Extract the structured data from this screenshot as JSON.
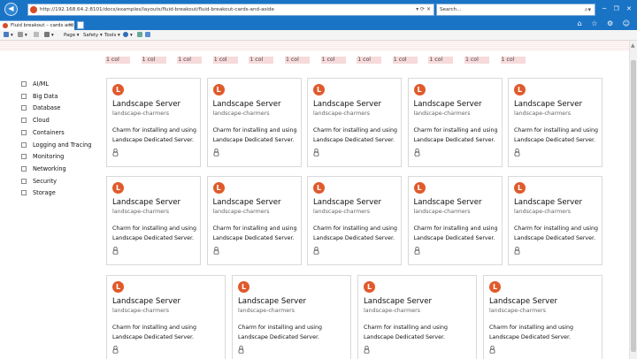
{
  "browser": {
    "url": "http://192.168.64.2:8101/docs/examples/layouts/fluid-breakout/fluid-breakout-cards-and-aside",
    "search_placeholder": "Search...",
    "tab_title": "Fluid breakout – cards and ...",
    "toolbar": {
      "page": "Page ▾",
      "safety": "Safety ▾",
      "tools": "Tools ▾"
    }
  },
  "grid_labels": [
    "1 col",
    "1 col",
    "1 col",
    "1 col",
    "1 col",
    "1 col",
    "1 col",
    "1 col",
    "1 col",
    "1 col",
    "1 col",
    "1 col"
  ],
  "filters": [
    "AI/ML",
    "Big Data",
    "Database",
    "Cloud",
    "Containers",
    "Logging and Tracing",
    "Monitoring",
    "Networking",
    "Security",
    "Storage"
  ],
  "cards": [
    {
      "title": "Landscape Server",
      "publisher": "landscape-charmers",
      "description": "Charm for installing and using Landscape Dedicated Server."
    },
    {
      "title": "Landscape Server",
      "publisher": "landscape-charmers",
      "description": "Charm for installing and using Landscape Dedicated Server."
    },
    {
      "title": "Landscape Server",
      "publisher": "landscape-charmers",
      "description": "Charm for installing and using Landscape Dedicated Server."
    },
    {
      "title": "Landscape Server",
      "publisher": "landscape-charmers",
      "description": "Charm for installing and using Landscape Dedicated Server."
    },
    {
      "title": "Landscape Server",
      "publisher": "landscape-charmers",
      "description": "Charm for installing and using Landscape Dedicated Server."
    },
    {
      "title": "Landscape Server",
      "publisher": "landscape-charmers",
      "description": "Charm for installing and using Landscape Dedicated Server."
    },
    {
      "title": "Landscape Server",
      "publisher": "landscape-charmers",
      "description": "Charm for installing and using Landscape Dedicated Server."
    },
    {
      "title": "Landscape Server",
      "publisher": "landscape-charmers",
      "description": "Charm for installing and using Landscape Dedicated Server."
    },
    {
      "title": "Landscape Server",
      "publisher": "landscape-charmers",
      "description": "Charm for installing and using Landscape Dedicated Server."
    },
    {
      "title": "Landscape Server",
      "publisher": "landscape-charmers",
      "description": "Charm for installing and using Landscape Dedicated Server."
    },
    {
      "title": "Landscape Server",
      "publisher": "landscape-charmers",
      "description": "Charm for installing and using Landscape Dedicated Server."
    },
    {
      "title": "Landscape Server",
      "publisher": "landscape-charmers",
      "description": "Charm for installing and using Landscape Dedicated Server."
    },
    {
      "title": "Landscape Server",
      "publisher": "landscape-charmers",
      "description": "Charm for installing and using Landscape Dedicated Server."
    },
    {
      "title": "Landscape Server",
      "publisher": "landscape-charmers",
      "description": "Charm for installing and using Landscape Dedicated Server."
    }
  ],
  "card_logo_letter": "L",
  "card_os_icon": "linux-icon",
  "colors": {
    "browser_chrome": "#1a74c6",
    "logo": "#e05a2b",
    "col_label_bg": "#f7dada"
  }
}
